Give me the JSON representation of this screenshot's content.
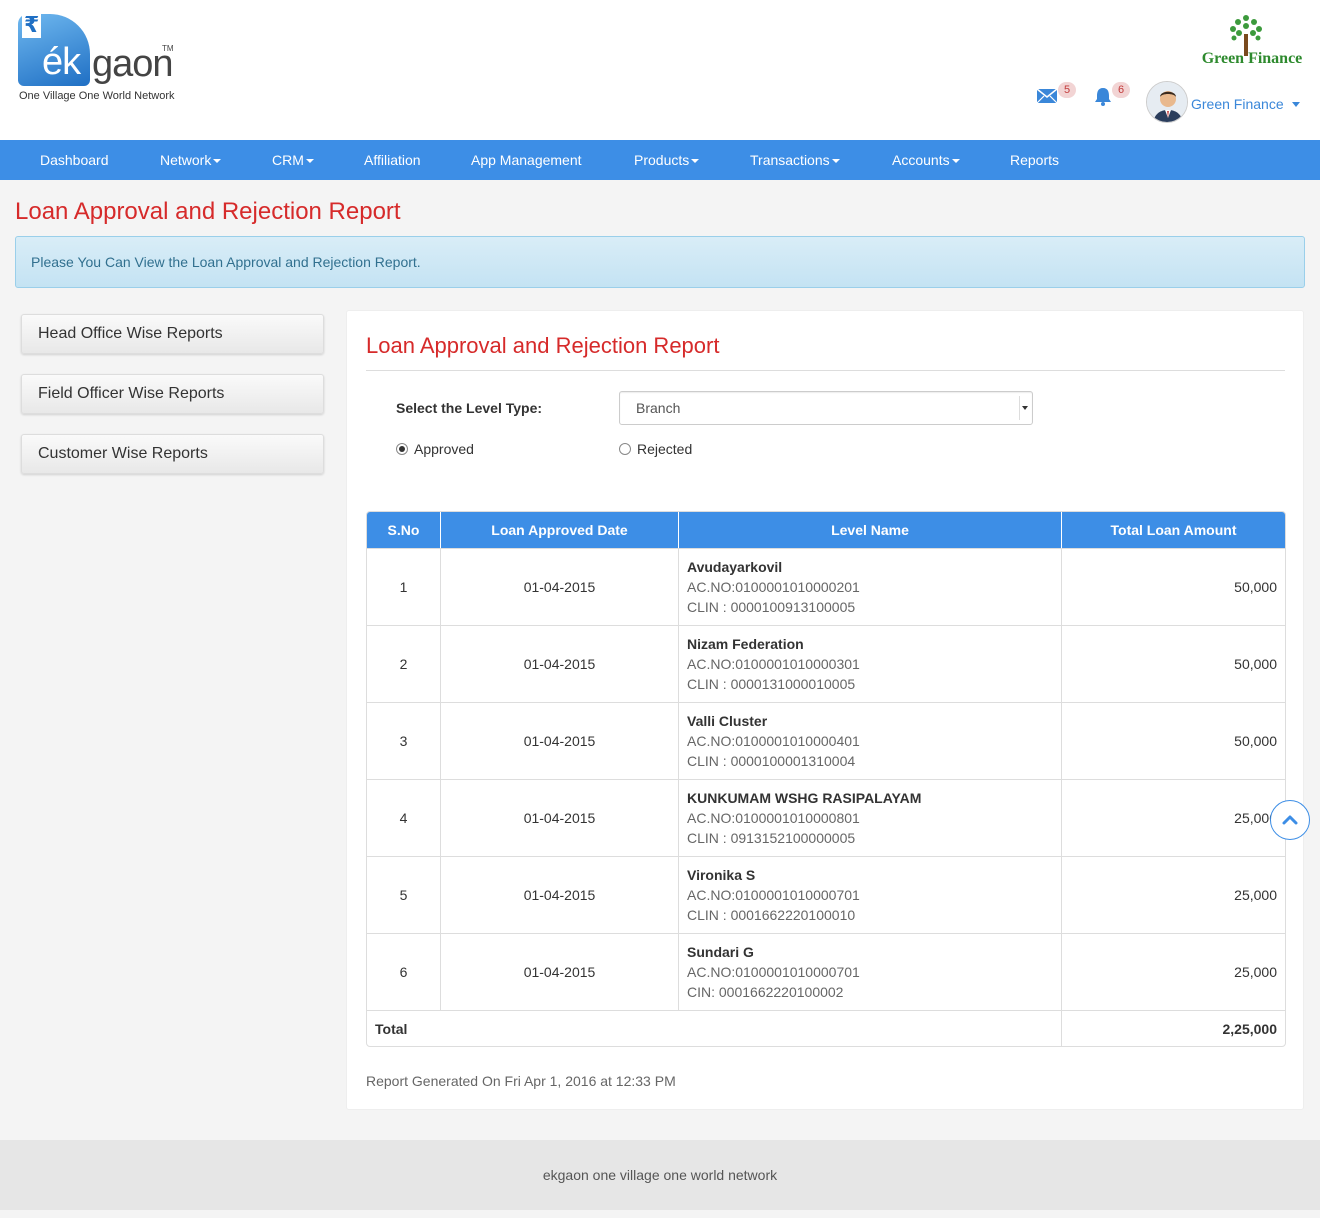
{
  "brand": {
    "rupee": "₹",
    "ek": "ék",
    "gaon": "gaon",
    "tm": "TM",
    "tagline": "One Village One World Network",
    "partner_logo_text": "Green Finance"
  },
  "header": {
    "mail_count": "5",
    "notification_count": "6",
    "user_name": "Green Finance"
  },
  "nav": [
    {
      "label": "Dashboard",
      "dropdown": false
    },
    {
      "label": "Network",
      "dropdown": true
    },
    {
      "label": "CRM",
      "dropdown": true
    },
    {
      "label": "Affiliation",
      "dropdown": false
    },
    {
      "label": "App Management",
      "dropdown": false
    },
    {
      "label": "Products",
      "dropdown": true
    },
    {
      "label": "Transactions",
      "dropdown": true
    },
    {
      "label": "Accounts",
      "dropdown": true
    },
    {
      "label": "Reports",
      "dropdown": false
    }
  ],
  "page": {
    "title": "Loan Approval and Rejection Report",
    "info": "Please You Can View the Loan Approval and Rejection Report."
  },
  "sidebar": [
    {
      "label": "Head Office Wise Reports"
    },
    {
      "label": "Field Officer Wise Reports"
    },
    {
      "label": "Customer Wise Reports"
    }
  ],
  "panel": {
    "title": "Loan Approval and Rejection Report",
    "level_label": "Select the Level Type:",
    "level_value": "Branch",
    "radio_approved": "Approved",
    "radio_rejected": "Rejected",
    "selected_radio": "Approved"
  },
  "table": {
    "headers": [
      "S.No",
      "Loan Approved Date",
      "Level Name",
      "Total Loan Amount"
    ],
    "rows": [
      {
        "sno": "1",
        "date": "01-04-2015",
        "name": "Avudayarkovil",
        "ac": "AC.NO:0100001010000201",
        "clin": "CLIN : 0000100913100005",
        "amount": "50,000"
      },
      {
        "sno": "2",
        "date": "01-04-2015",
        "name": "Nizam Federation",
        "ac": "AC.NO:0100001010000301",
        "clin": "CLIN : 0000131000010005",
        "amount": "50,000"
      },
      {
        "sno": "3",
        "date": "01-04-2015",
        "name": "Valli Cluster",
        "ac": "AC.NO:0100001010000401",
        "clin": "CLIN : 0000100001310004",
        "amount": "50,000"
      },
      {
        "sno": "4",
        "date": "01-04-2015",
        "name": "KUNKUMAM WSHG RASIPALAYAM",
        "ac": "AC.NO:0100001010000801",
        "clin": "CLIN : 0913152100000005",
        "amount": "25,000"
      },
      {
        "sno": "5",
        "date": "01-04-2015",
        "name": "Vironika S",
        "ac": "AC.NO:0100001010000701",
        "clin": "CLIN : 0001662220100010",
        "amount": "25,000"
      },
      {
        "sno": "6",
        "date": "01-04-2015",
        "name": "Sundari G",
        "ac": "AC.NO:0100001010000701",
        "clin": "CIN: 0001662220100002",
        "amount": "25,000"
      }
    ],
    "total_label": "Total",
    "total_amount": "2,25,000"
  },
  "generated": "Report Generated On Fri Apr 1, 2016 at 12:33 PM",
  "footer": "ekgaon one village one world network",
  "colors": {
    "nav_bg": "#3d8ee6",
    "title_red": "#d62a2a",
    "info_text": "#31708f"
  }
}
